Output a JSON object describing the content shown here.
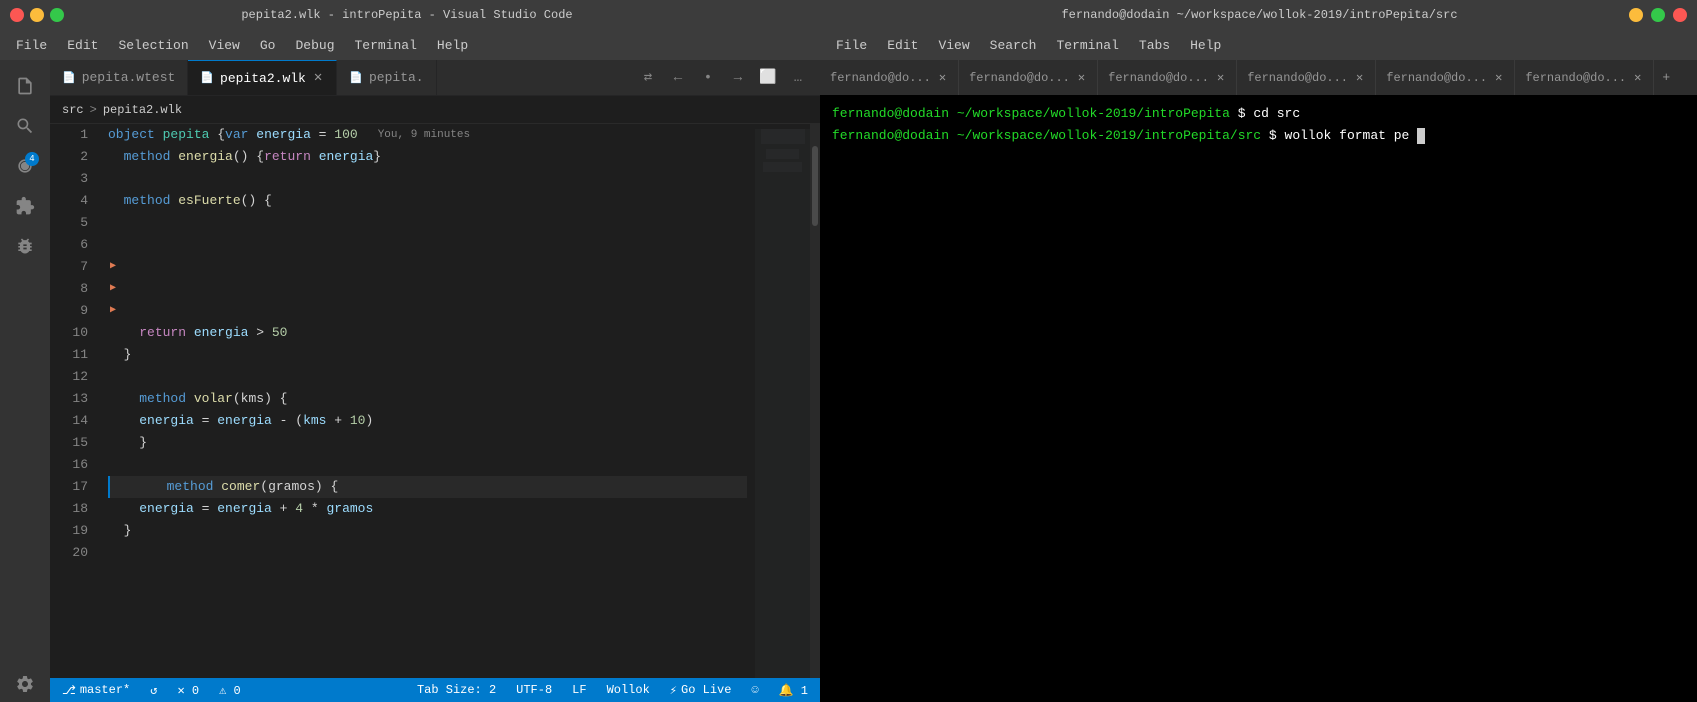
{
  "titlebar": {
    "vscode": {
      "title": "pepita2.wlk - introPepita - Visual Studio Code",
      "min": "–",
      "max": "□",
      "close": "✕"
    },
    "terminal": {
      "title": "fernando@dodain ~/workspace/wollok-2019/introPepita/src",
      "min": "–",
      "max": "□",
      "close": "✕"
    }
  },
  "menu": {
    "vscode": [
      "File",
      "Edit",
      "Selection",
      "View",
      "Go",
      "Debug",
      "Terminal",
      "Help"
    ],
    "terminal": [
      "File",
      "Edit",
      "View",
      "Search",
      "Terminal",
      "Tabs",
      "Help"
    ]
  },
  "tabs": {
    "items": [
      {
        "id": "pepita-wtest",
        "icon": "📄",
        "label": "pepita.wtest",
        "active": false,
        "closable": false
      },
      {
        "id": "pepita2-wlk",
        "icon": "📄",
        "label": "pepita2.wlk",
        "active": true,
        "closable": true
      },
      {
        "id": "pepita-wlk",
        "icon": "📄",
        "label": "pepita.",
        "active": false,
        "closable": false
      }
    ],
    "actions": [
      "⇄",
      "←",
      "•",
      "→",
      "⬜",
      "☰",
      "…"
    ]
  },
  "breadcrumb": {
    "parts": [
      "src",
      ">",
      "pepita2.wlk"
    ]
  },
  "code": {
    "lines": [
      {
        "num": 1,
        "content": "object pepita {var energia = 100",
        "hint": "You, 9 minutes"
      },
      {
        "num": 2,
        "content": "  method energia() {return energia}"
      },
      {
        "num": 3,
        "content": ""
      },
      {
        "num": 4,
        "content": "  method esFuerte() {"
      },
      {
        "num": 5,
        "content": ""
      },
      {
        "num": 6,
        "content": ""
      },
      {
        "num": 7,
        "content": "",
        "fold": true
      },
      {
        "num": 8,
        "content": "",
        "fold": true
      },
      {
        "num": 9,
        "content": "",
        "fold": true
      },
      {
        "num": 10,
        "content": "    return energia > 50"
      },
      {
        "num": 11,
        "content": "  }"
      },
      {
        "num": 12,
        "content": ""
      },
      {
        "num": 13,
        "content": "    method volar(kms) {"
      },
      {
        "num": 14,
        "content": "    energia = energia - (kms + 10)"
      },
      {
        "num": 15,
        "content": "    }"
      },
      {
        "num": 16,
        "content": ""
      },
      {
        "num": 17,
        "content": "      method comer(gramos) {",
        "highlight": true
      },
      {
        "num": 18,
        "content": "    energia = energia + 4 * gramos"
      },
      {
        "num": 19,
        "content": "  }"
      },
      {
        "num": 20,
        "content": ""
      }
    ]
  },
  "statusbar": {
    "branch": "master*",
    "sync": "↺",
    "errors": "✕ 0",
    "warnings": "⚠ 0",
    "tabsize": "Tab Size: 2",
    "encoding": "UTF-8",
    "eol": "LF",
    "language": "Wollok",
    "golive": "Go Live",
    "smiley": "☺",
    "bell": "🔔 1"
  },
  "terminal": {
    "tabs": [
      {
        "label": "fernando@do...",
        "close": "✕"
      },
      {
        "label": "fernando@do...",
        "close": "✕"
      },
      {
        "label": "fernando@do...",
        "close": "✕"
      },
      {
        "label": "fernando@do...",
        "close": "✕"
      },
      {
        "label": "fernando@do...",
        "close": "✕"
      },
      {
        "label": "fernando@do...",
        "close": "✕"
      }
    ],
    "lines": [
      {
        "prompt_user": "fernando@dodain",
        "prompt_path": " ~/workspace/wollok-2019/introPepita",
        "prompt_sym": " $",
        "cmd": " cd src"
      },
      {
        "prompt_user": "fernando@dodain",
        "prompt_path": " ~/workspace/wollok-2019/introPepita/src",
        "prompt_sym": " $",
        "cmd": " wollok format pe",
        "cursor": true
      }
    ]
  },
  "activity": {
    "icons": [
      {
        "name": "files",
        "symbol": "⧉",
        "active": false
      },
      {
        "name": "search",
        "symbol": "🔍",
        "active": false
      },
      {
        "name": "source-control",
        "symbol": "⑂",
        "active": false,
        "badge": "4"
      },
      {
        "name": "extensions",
        "symbol": "⊞",
        "active": false
      },
      {
        "name": "debug",
        "symbol": "▶",
        "active": false
      }
    ],
    "bottom": [
      {
        "name": "settings",
        "symbol": "⚙"
      }
    ]
  }
}
